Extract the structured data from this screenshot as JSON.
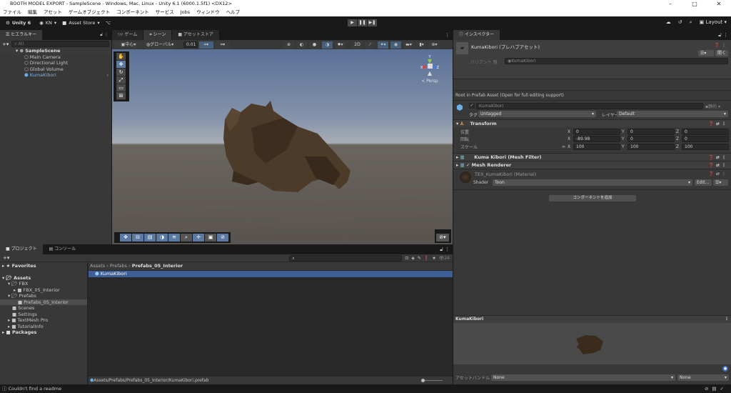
{
  "window": {
    "title": "BOOTH MODEL EXPORT - SampleScene - Windows, Mac, Linux - Unity 6.1 (6000.1.5f1) <DX12>",
    "min": "–",
    "max": "□",
    "close": "✕"
  },
  "menu": [
    "ファイル",
    "編集",
    "アセット",
    "ゲームオブジェクト",
    "コンポーネント",
    "サービス",
    "Jobs",
    "ウィンドウ",
    "ヘルプ"
  ],
  "toolbar": {
    "unity": "Unity 6",
    "account": "KN",
    "asset_store": "Asset Store",
    "layout": "Layout"
  },
  "hierarchy": {
    "tab": "ヒエラルキー",
    "search_placeholder": "All",
    "scene": "SampleScene",
    "items": [
      "Main Camera",
      "Directional Light",
      "Global Volume",
      "KumaKibori"
    ]
  },
  "scene": {
    "tabs": [
      "ゲーム",
      "シーン",
      "アセットストア"
    ],
    "pivot": "中心",
    "space": "グローバル",
    "snap": "0.01",
    "persp": "Persp",
    "axes": {
      "x": "X",
      "y": "Y",
      "z": "Z"
    }
  },
  "inspector": {
    "tab": "インスペクター",
    "object_title": "KumaKibori (プレハブアセット)",
    "open_btn": "開く",
    "variant_label": "バリアント 親",
    "variant_value": "KumaKibori",
    "root_note": "Root in Prefab Asset (Open for full editing support)",
    "name": "KumaKibori",
    "static": "静的",
    "tag_label": "タグ",
    "tag": "Untagged",
    "layer_label": "レイヤー",
    "layer": "Default",
    "transform": {
      "title": "Transform",
      "rows": [
        {
          "label": "位置",
          "x": "0",
          "y": "0",
          "z": "0"
        },
        {
          "label": "回転",
          "x": "-89.98",
          "y": "0",
          "z": "0"
        },
        {
          "label": "スケール",
          "x": "100",
          "y": "100",
          "z": "100"
        }
      ]
    },
    "mesh_filter": "Kuma Kibori (Mesh Filter)",
    "mesh_renderer": "Mesh Renderer",
    "material": "TEX_KumaKibori (Material)",
    "shader_label": "Shader",
    "shader": "Toon",
    "edit": "Edit...",
    "add_component": "コンポーネントを追加",
    "preview_title": "KumaKibori",
    "asset_bundle_label": "アセットバンドル",
    "bundle": "None",
    "variant": "None"
  },
  "project": {
    "tabs": [
      "プロジェクト",
      "コンソール"
    ],
    "favorites": "Favorites",
    "tree": [
      "Assets",
      "FBX",
      "FBX_05_Interior",
      "Prefabs",
      "Prefabs_05_Interior",
      "Scenes",
      "Settings",
      "TextMesh Pro",
      "TutorialInfo",
      "Packages"
    ],
    "breadcrumb": [
      "Assets",
      "Prefabs",
      "Prefabs_05_Interior"
    ],
    "files": [
      "KumaKibori"
    ],
    "count": "24",
    "path": "Assets/Prefabs/Prefabs_05_Interior/KumaKibori.prefab"
  },
  "status": {
    "message": "Couldn't find a readme"
  }
}
